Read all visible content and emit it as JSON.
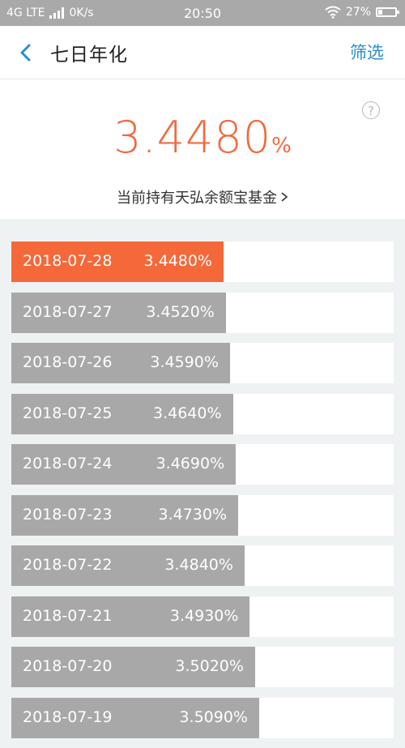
{
  "status_bar": {
    "network": "4G LTE",
    "speed": "0K/s",
    "time": "20:50",
    "battery": "27%",
    "battery_level": 0.27
  },
  "nav": {
    "title": "七日年化",
    "filter_label": "筛选"
  },
  "hero": {
    "rate_value": "3.4480",
    "rate_unit": "%",
    "help_symbol": "?",
    "fund_link": "当前持有天弘余额宝基金"
  },
  "rates": {
    "selected_index": 0,
    "items": [
      {
        "date": "2018-07-28",
        "value": "3.4480%",
        "rate": 3.448
      },
      {
        "date": "2018-07-27",
        "value": "3.4520%",
        "rate": 3.452
      },
      {
        "date": "2018-07-26",
        "value": "3.4590%",
        "rate": 3.459
      },
      {
        "date": "2018-07-25",
        "value": "3.4640%",
        "rate": 3.464
      },
      {
        "date": "2018-07-24",
        "value": "3.4690%",
        "rate": 3.469
      },
      {
        "date": "2018-07-23",
        "value": "3.4730%",
        "rate": 3.473
      },
      {
        "date": "2018-07-22",
        "value": "3.4840%",
        "rate": 3.484
      },
      {
        "date": "2018-07-21",
        "value": "3.4930%",
        "rate": 3.493
      },
      {
        "date": "2018-07-20",
        "value": "3.5020%",
        "rate": 3.502
      },
      {
        "date": "2018-07-19",
        "value": "3.5090%",
        "rate": 3.509
      }
    ]
  }
}
